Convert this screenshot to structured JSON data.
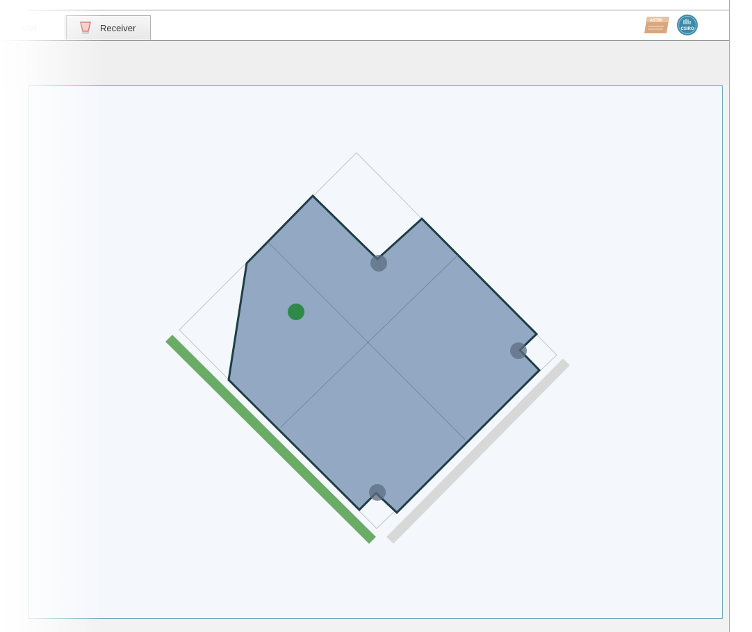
{
  "tabs": [
    {
      "label": "stat",
      "active": false
    },
    {
      "label": "Receiver",
      "active": true
    }
  ],
  "logos": {
    "astri": {
      "text": "ASTRI",
      "icon": "astri-logo-icon"
    },
    "csiro": {
      "text": "CSIRO",
      "icon": "csiro-logo-icon"
    }
  },
  "colors": {
    "polygon_fill": "#93a8c2",
    "polygon_stroke": "#1e3d45",
    "handle": "#5c6e82",
    "start_point": "#2f8a4a",
    "green_bar": "#6aab66",
    "grey_bar": "#d8d8d8",
    "canvas_bg": "#f4f7fc",
    "canvas_border": "#6aaab8"
  },
  "icons": {
    "receiver_tab": "receiver-icon",
    "control_handle": "handle-icon",
    "start_marker": "green-dot-icon"
  }
}
